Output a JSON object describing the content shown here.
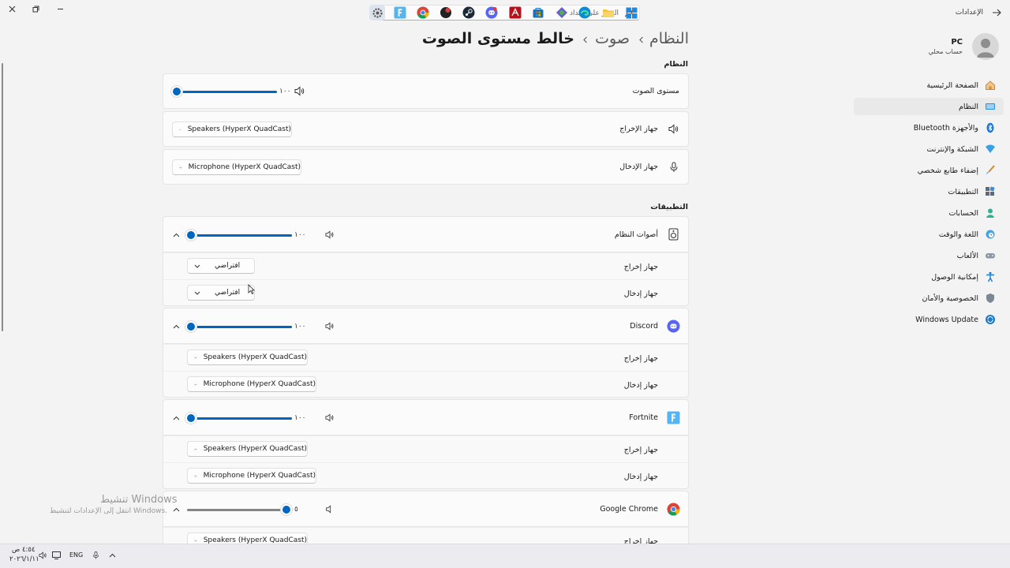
{
  "window": {
    "title": "الإعدادات",
    "controls": [
      "minimize",
      "maximize",
      "close"
    ]
  },
  "search": {
    "placeholder": "العثور على إعداد"
  },
  "profile": {
    "name": "PC",
    "subtitle": "حساب محلي"
  },
  "sidebar": {
    "items": [
      {
        "label": "الصفحة الرئيسية",
        "icon": "home-icon",
        "active": false
      },
      {
        "label": "النظام",
        "icon": "system-icon",
        "active": true
      },
      {
        "label": "Bluetooth والأجهزة",
        "icon": "bluetooth-icon",
        "active": false
      },
      {
        "label": "الشبكة والإنترنت",
        "icon": "network-icon",
        "active": false
      },
      {
        "label": "إضفاء طابع شخصي",
        "icon": "brush-icon",
        "active": false
      },
      {
        "label": "التطبيقات",
        "icon": "apps-icon",
        "active": false
      },
      {
        "label": "الحسابات",
        "icon": "account-icon",
        "active": false
      },
      {
        "label": "اللغة والوقت",
        "icon": "globe-clock-icon",
        "active": false
      },
      {
        "label": "الألعاب",
        "icon": "gamepad-icon",
        "active": false
      },
      {
        "label": "إمكانية الوصول",
        "icon": "accessibility-icon",
        "active": false
      },
      {
        "label": "الخصوصية والأمان",
        "icon": "shield-icon",
        "active": false
      },
      {
        "label": "Windows Update",
        "icon": "update-icon",
        "active": false
      }
    ]
  },
  "breadcrumb": {
    "items": [
      "النظام",
      "صوت"
    ],
    "current": "خالط مستوى الصوت"
  },
  "system_section": {
    "heading": "النظام",
    "volume": {
      "label": "مستوى الصوت",
      "value": "١٠٠",
      "level": 100
    },
    "output": {
      "label": "جهاز الإخراج",
      "value": "Speakers (HyperX QuadCast)"
    },
    "input": {
      "label": "جهاز الإدخال",
      "value": "Microphone (HyperX QuadCast)"
    }
  },
  "apps_section": {
    "heading": "التطبيقات",
    "output_label": "جهاز إخراج",
    "input_label": "جهاز إدخال",
    "apps": [
      {
        "name": "أصوات النظام",
        "icon": "speaker-box-icon",
        "volume": "١٠٠",
        "level": 100,
        "output": "افتراضي",
        "input": "افتراضي"
      },
      {
        "name": "Discord",
        "icon": "discord-icon",
        "volume": "١٠٠",
        "level": 100,
        "output": "Speakers (HyperX QuadCast)",
        "input": "Microphone (HyperX QuadCast)"
      },
      {
        "name": "Fortnite",
        "icon": "fortnite-icon",
        "volume": "١٠٠",
        "level": 100,
        "output": "Speakers (HyperX QuadCast)",
        "input": "Microphone (HyperX QuadCast)"
      },
      {
        "name": "Google Chrome",
        "icon": "chrome-icon",
        "volume": "٥",
        "level": 5,
        "output": "Speakers (HyperX QuadCast)"
      }
    ]
  },
  "watermark": {
    "title": "تنشيط Windows",
    "subtitle": "انتقل إلى الإعدادات لتنشيط Windows."
  },
  "taskbar": {
    "language": "ENG",
    "time": "٤:٥٤ ص",
    "date": "٢٠٢٦/١/١١",
    "apps": [
      "settings-icon",
      "fortnite-icon",
      "chrome-icon",
      "app-icon",
      "steam-icon",
      "discord-icon",
      "adobe-icon",
      "store-icon",
      "app-icon",
      "edge-icon",
      "file-explorer-icon",
      "start-icon"
    ]
  }
}
